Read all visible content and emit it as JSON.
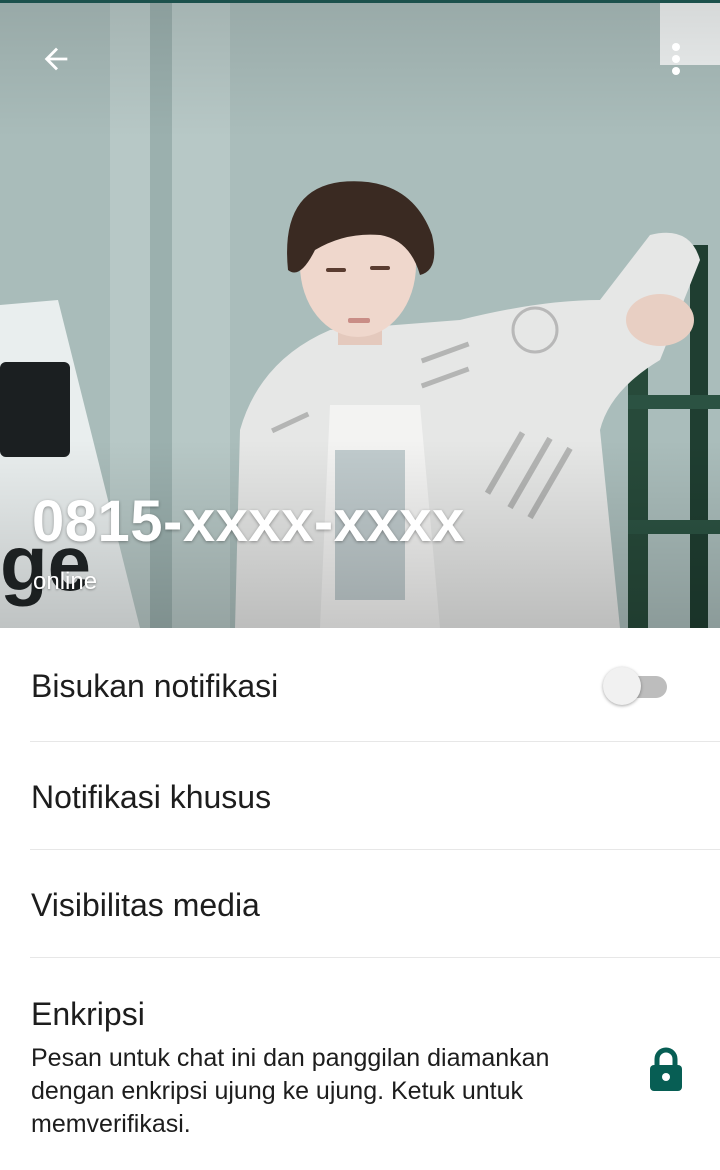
{
  "header": {
    "contact_name": "0815-xxxx-xxxx",
    "status": "online",
    "back_icon": "arrow-left-icon",
    "menu_icon": "more-vert-icon"
  },
  "settings": {
    "mute_notifications": {
      "label": "Bisukan notifikasi",
      "enabled": false
    },
    "custom_notifications": {
      "label": "Notifikasi khusus"
    },
    "media_visibility": {
      "label": "Visibilitas media"
    },
    "encryption": {
      "label": "Enkripsi",
      "description": "Pesan untuk chat ini dan panggilan diamankan dengan enkripsi ujung ke ujung. Ketuk untuk memverifikasi.",
      "icon": "lock-icon"
    }
  },
  "colors": {
    "accent": "#075e54",
    "toggle_off_track": "#bdbdbd",
    "toggle_off_thumb": "#f1f1f1",
    "text_primary": "#1d1d1d",
    "divider": "#e7e7e7"
  }
}
